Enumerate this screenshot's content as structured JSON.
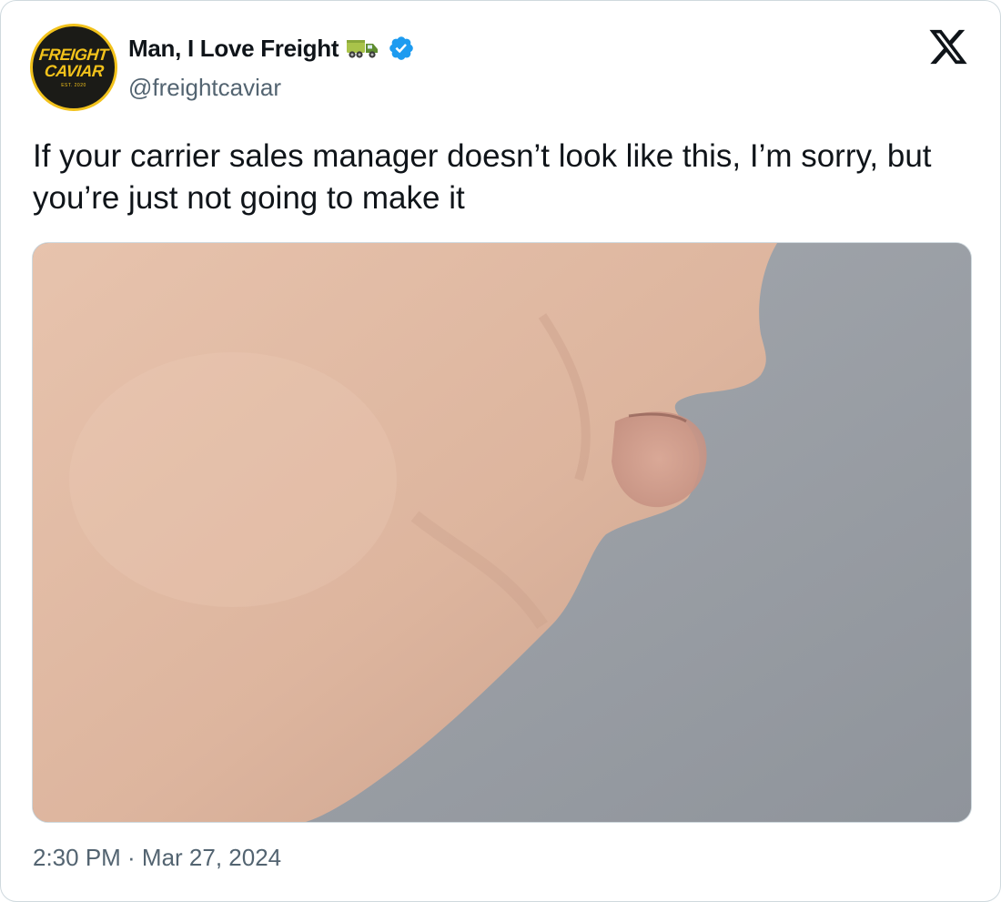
{
  "author": {
    "avatar_text_line1": "FREIGHT",
    "avatar_text_line2": "CAVIAR",
    "avatar_text_line3": "EST. 2020",
    "display_name": "Man, I Love Freight",
    "name_emoji": "truck-icon",
    "verified_badge": "verified-badge-icon",
    "handle": "@freightcaviar"
  },
  "platform_logo": "x-logo-icon",
  "tweet": {
    "text": "If your carrier sales manager doesn’t look like this, I’m sorry, but you’re just not going to make it",
    "media_description_icon": "photo",
    "timestamp": "2:30 PM · Mar 27, 2024"
  },
  "colors": {
    "text_primary": "#0f1419",
    "text_secondary": "#536471",
    "verified_blue": "#1d9bf0",
    "border": "#cfd9de",
    "avatar_bg": "#1b1b17",
    "avatar_accent": "#f2c21b"
  }
}
